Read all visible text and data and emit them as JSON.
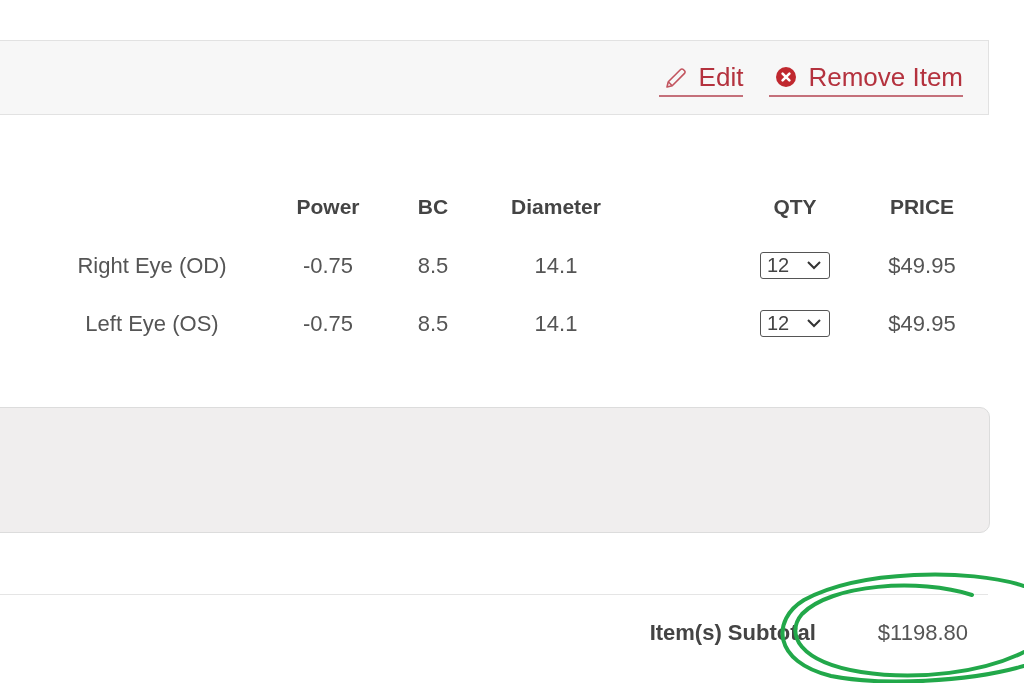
{
  "item_actions": [
    {
      "kind": "edit",
      "label": "Edit"
    },
    {
      "kind": "remove",
      "label": "Remove Item"
    }
  ],
  "prescription_table": {
    "columns": [
      {
        "kind": "text",
        "label": "Power"
      },
      {
        "kind": "text",
        "label": "BC"
      },
      {
        "kind": "text",
        "label": "Diameter"
      },
      {
        "kind": "select",
        "label": "QTY"
      },
      {
        "kind": "text",
        "label": "PRICE"
      }
    ],
    "rows": [
      {
        "eye": "Right Eye (OD)",
        "cells": [
          "-0.75",
          "8.5",
          "14.1",
          "12",
          "$49.95"
        ]
      },
      {
        "eye": "Left Eye (OS)",
        "cells": [
          "-0.75",
          "8.5",
          "14.1",
          "12",
          "$49.95"
        ]
      }
    ]
  },
  "subtotal": {
    "label": "Item(s) Subtotal",
    "value": "$1198.80",
    "circled": true
  }
}
